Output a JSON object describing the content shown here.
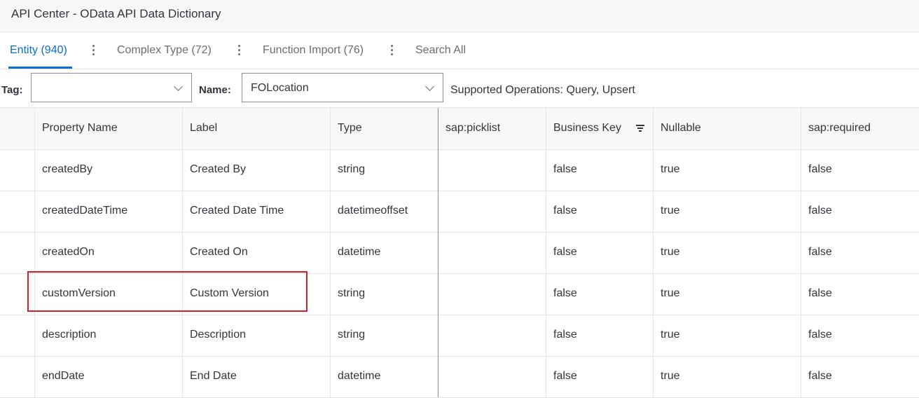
{
  "app": {
    "title": "API Center - OData API Data Dictionary"
  },
  "tabs": [
    {
      "label": "Entity (940)",
      "active": true
    },
    {
      "label": "Complex Type (72)",
      "active": false
    },
    {
      "label": "Function Import (76)",
      "active": false
    },
    {
      "label": "Search All",
      "active": false
    }
  ],
  "filters": {
    "tag_label": "Tag:",
    "tag_value": "",
    "name_label": "Name:",
    "name_value": "FOLocation",
    "supported_ops": "Supported Operations: Query, Upsert"
  },
  "table": {
    "columns": [
      "Property Name",
      "Label",
      "Type",
      "sap:picklist",
      "Business Key",
      "Nullable",
      "sap:required"
    ],
    "rows": [
      [
        "createdBy",
        "Created By",
        "string",
        "",
        "false",
        "true",
        "false"
      ],
      [
        "createdDateTime",
        "Created Date Time",
        "datetimeoffset",
        "",
        "false",
        "true",
        "false"
      ],
      [
        "createdOn",
        "Created On",
        "datetime",
        "",
        "false",
        "true",
        "false"
      ],
      [
        "customVersion",
        "Custom Version",
        "string",
        "",
        "false",
        "true",
        "false"
      ],
      [
        "description",
        "Description",
        "string",
        "",
        "false",
        "true",
        "false"
      ],
      [
        "endDate",
        "End Date",
        "datetime",
        "",
        "false",
        "true",
        "false"
      ]
    ]
  },
  "colors": {
    "accent": "#0a6ed1",
    "highlight": "#d0202d"
  },
  "icons": [
    "more-vertical-icon",
    "chevron-down-icon",
    "sort-filter-icon"
  ]
}
